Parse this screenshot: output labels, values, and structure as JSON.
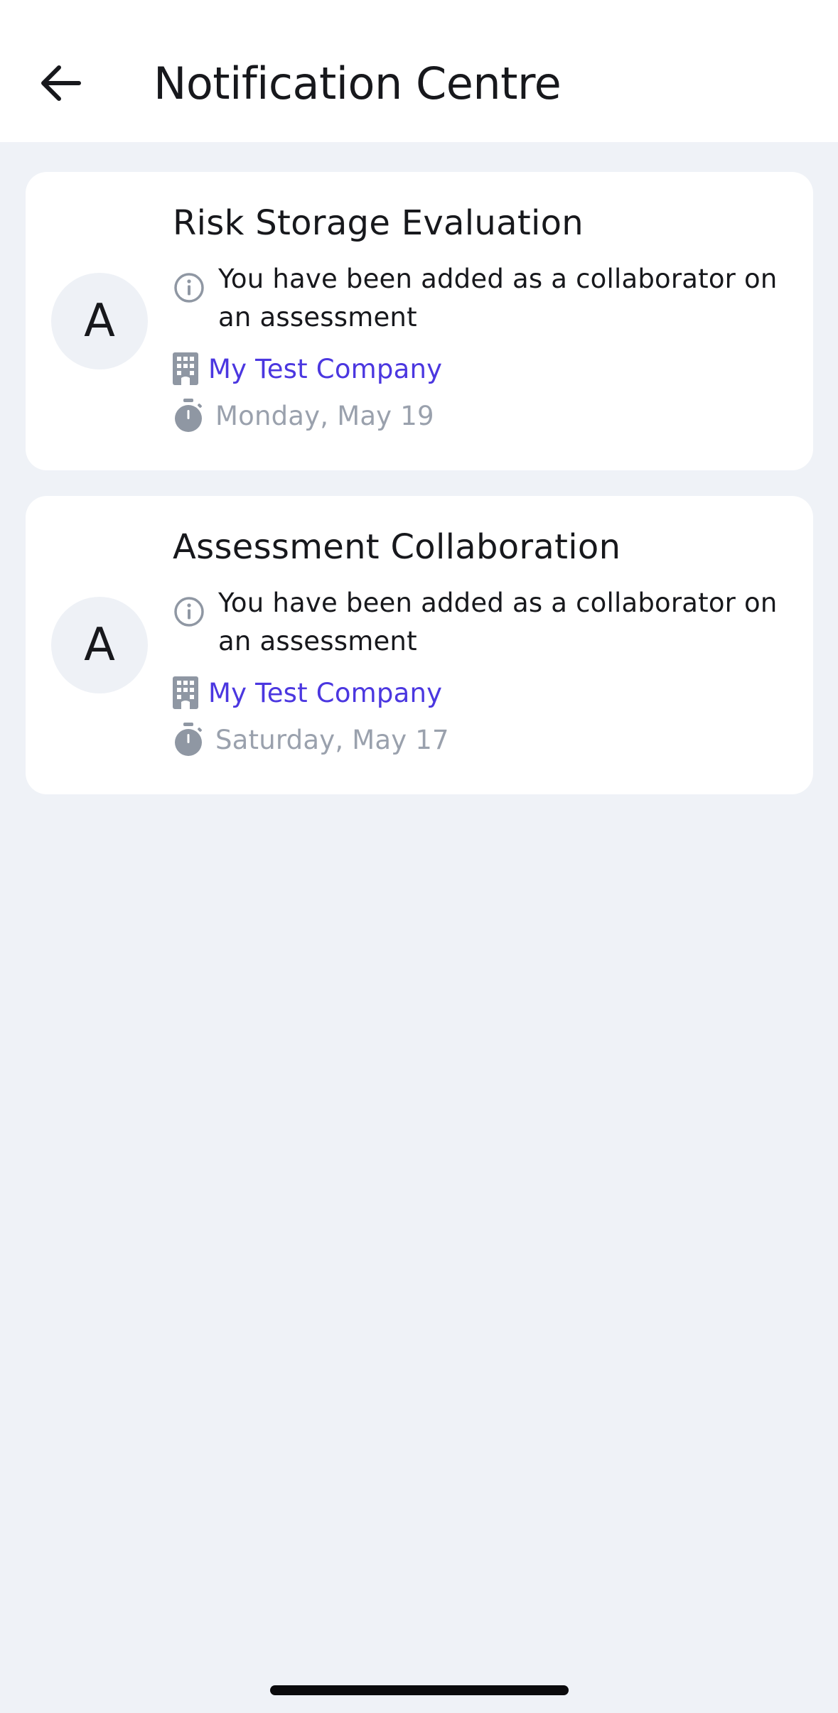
{
  "header": {
    "title": "Notification Centre",
    "back_icon": "arrow-left-icon"
  },
  "notifications": [
    {
      "avatar_letter": "A",
      "title": "Risk Storage Evaluation",
      "message": "You have been added as a collaborator on an assessment",
      "company": "My Test Company",
      "date": "Monday, May 19"
    },
    {
      "avatar_letter": "A",
      "title": "Assessment Collaboration",
      "message": "You have been added as a collaborator on an assessment",
      "company": "My Test Company",
      "date": "Saturday, May 17"
    }
  ],
  "colors": {
    "background": "#eff2f7",
    "card": "#ffffff",
    "link": "#4b37e0",
    "muted": "#9aa1ad",
    "icon": "#8f97a3"
  }
}
